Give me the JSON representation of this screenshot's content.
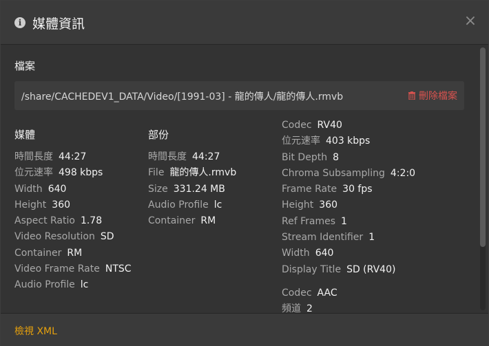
{
  "header": {
    "title": "媒體資訊"
  },
  "file_section": {
    "title": "檔案",
    "path": "/share/CACHEDEV1_DATA/Video/[1991-03] - 龍的傳人/龍的傳人.rmvb",
    "delete_label": "刪除檔案"
  },
  "media": {
    "title": "媒體",
    "rows": [
      {
        "k": "時間長度",
        "v": "44:27"
      },
      {
        "k": "位元速率",
        "v": "498 kbps"
      },
      {
        "k": "Width",
        "v": "640"
      },
      {
        "k": "Height",
        "v": "360"
      },
      {
        "k": "Aspect Ratio",
        "v": "1.78"
      },
      {
        "k": "Video Resolution",
        "v": "SD"
      },
      {
        "k": "Container",
        "v": "RM"
      },
      {
        "k": "Video Frame Rate",
        "v": "NTSC"
      },
      {
        "k": "Audio Profile",
        "v": "lc"
      }
    ]
  },
  "part": {
    "title": "部份",
    "rows": [
      {
        "k": "時間長度",
        "v": "44:27"
      },
      {
        "k": "File",
        "v": "龍的傳人.rmvb"
      },
      {
        "k": "Size",
        "v": "331.24 MB"
      },
      {
        "k": "Audio Profile",
        "v": "lc"
      },
      {
        "k": "Container",
        "v": "RM"
      }
    ]
  },
  "video_stream": {
    "rows": [
      {
        "k": "Codec",
        "v": "RV40"
      },
      {
        "k": "位元速率",
        "v": "403 kbps"
      },
      {
        "k": "Bit Depth",
        "v": "8"
      },
      {
        "k": "Chroma Subsampling",
        "v": "4:2:0"
      },
      {
        "k": "Frame Rate",
        "v": "30 fps"
      },
      {
        "k": "Height",
        "v": "360"
      },
      {
        "k": "Ref Frames",
        "v": "1"
      },
      {
        "k": "Stream Identifier",
        "v": "1"
      },
      {
        "k": "Width",
        "v": "640"
      },
      {
        "k": "Display Title",
        "v": "SD (RV40)"
      }
    ]
  },
  "audio_stream": {
    "rows": [
      {
        "k": "Codec",
        "v": "AAC"
      },
      {
        "k": "頻道",
        "v": "2"
      }
    ]
  },
  "footer": {
    "xml_label": "檢視 XML"
  },
  "colors": {
    "accent": "#e5a00d",
    "danger": "#d9534f",
    "background": "#333333"
  }
}
